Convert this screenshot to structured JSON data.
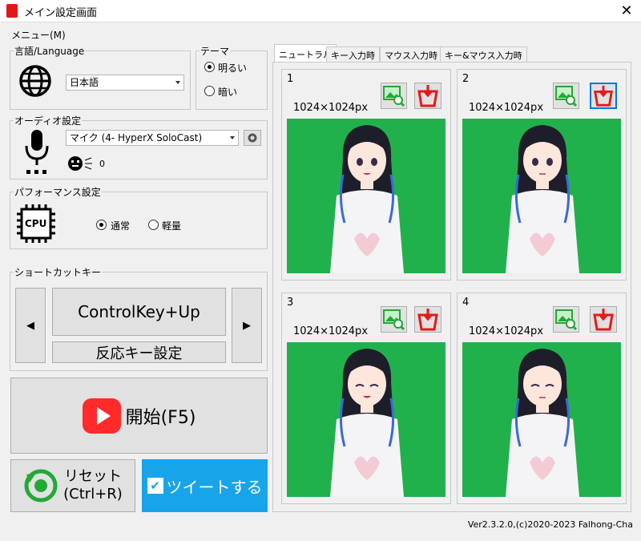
{
  "window": {
    "title": "メイン設定画面",
    "close": "✕"
  },
  "menu": {
    "label": "メニュー(M)"
  },
  "language": {
    "legend": "言語/Language",
    "selected": "日本語"
  },
  "theme": {
    "legend": "テーマ",
    "options": [
      {
        "label": "明るい",
        "checked": true
      },
      {
        "label": "暗い",
        "checked": false
      }
    ]
  },
  "audio": {
    "legend": "オーディオ設定",
    "device": "マイク (4- HyperX SoloCast)",
    "level": "0"
  },
  "performance": {
    "legend": "パフォーマンス設定",
    "cpu_label": "CPU",
    "options": [
      {
        "label": "通常",
        "checked": true
      },
      {
        "label": "軽量",
        "checked": false
      }
    ]
  },
  "shortcut": {
    "legend": "ショートカットキー",
    "prev": "◀",
    "next": "▶",
    "key": "ControlKey+Up",
    "set_label": "反応キー設定"
  },
  "start": {
    "label": "開始(F5)"
  },
  "reset": {
    "line1": "リセット",
    "line2": "(Ctrl+R)"
  },
  "tweet": {
    "label": "ツイートする",
    "check": "✔"
  },
  "tabs": [
    {
      "label": "ニュートラル",
      "active": true
    },
    {
      "label": "キー入力時",
      "active": false
    },
    {
      "label": "マウス入力時",
      "active": false
    },
    {
      "label": "キー&マウス入力時",
      "active": false
    }
  ],
  "images": [
    {
      "number": "1",
      "size": "1024×1024px",
      "expression": "smile"
    },
    {
      "number": "2",
      "size": "1024×1024px",
      "expression": "neutral"
    },
    {
      "number": "3",
      "size": "1024×1024px",
      "expression": "eyes-closed"
    },
    {
      "number": "4",
      "size": "1024×1024px",
      "expression": "eyes-closed"
    }
  ],
  "version": "Ver2.3.2.0,(c)2020-2023 Falhong-Cha",
  "colors": {
    "green_screen": "#21b14c",
    "accent_blue": "#18a4e8",
    "start_red": "#ff2a2a",
    "reset_green": "#22a836",
    "delete_red": "#e81818"
  }
}
